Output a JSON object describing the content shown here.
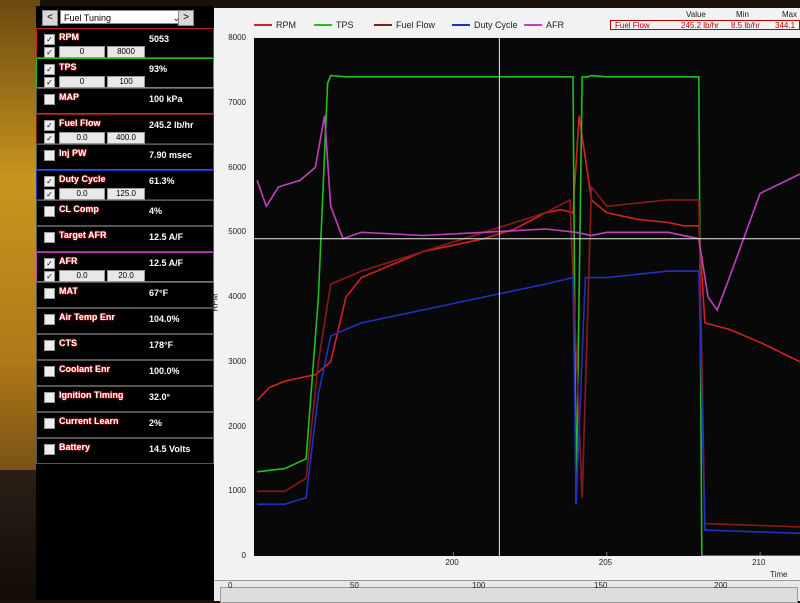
{
  "toolbar": {
    "prev_label": "<",
    "next_label": ">",
    "selector_value": "Fuel Tuning"
  },
  "sensors": [
    {
      "name": "RPM",
      "value": "5053",
      "checked": true,
      "range_min": "0",
      "range_max": "8000"
    },
    {
      "name": "TPS",
      "value": "93%",
      "checked": true,
      "range_min": "0",
      "range_max": "100"
    },
    {
      "name": "MAP",
      "value": "100 kPa",
      "checked": false
    },
    {
      "name": "Fuel Flow",
      "value": "245.2 lb/hr",
      "checked": true,
      "range_min": "0.0",
      "range_max": "400.0"
    },
    {
      "name": "Inj PW",
      "value": "7.90 msec",
      "checked": false
    },
    {
      "name": "Duty Cycle",
      "value": "61.3%",
      "checked": true,
      "range_min": "0.0",
      "range_max": "125.0"
    },
    {
      "name": "CL Comp",
      "value": "4%",
      "checked": false
    },
    {
      "name": "Target AFR",
      "value": "12.5 A/F",
      "checked": false
    },
    {
      "name": "AFR",
      "value": "12.5 A/F",
      "checked": true,
      "range_min": "0.0",
      "range_max": "20.0"
    },
    {
      "name": "MAT",
      "value": "67°F",
      "checked": false
    },
    {
      "name": "Air Temp Enr",
      "value": "104.0%",
      "checked": false
    },
    {
      "name": "CTS",
      "value": "178°F",
      "checked": false
    },
    {
      "name": "Coolant Enr",
      "value": "100.0%",
      "checked": false
    },
    {
      "name": "Ignition Timing",
      "value": "32.0°",
      "checked": false
    },
    {
      "name": "Current Learn",
      "value": "2%",
      "checked": false
    },
    {
      "name": "Battery",
      "value": "14.5 Volts",
      "checked": false
    }
  ],
  "legend": [
    {
      "name": "RPM",
      "color": "#d42020"
    },
    {
      "name": "TPS",
      "color": "#20c020"
    },
    {
      "name": "Fuel Flow",
      "color": "#8a1a1a"
    },
    {
      "name": "Duty Cycle",
      "color": "#2030c0"
    },
    {
      "name": "AFR",
      "color": "#c040c0"
    }
  ],
  "info_table": {
    "col_value": "Value",
    "col_min": "Min",
    "col_max": "Max",
    "row_name": "Fuel Flow",
    "row_value": "245.2 lb/hr",
    "row_min": "8.5 lb/hr",
    "row_max": "344.1"
  },
  "chart_data": {
    "type": "line",
    "ylabel": "RPM",
    "xlabel": "Time (sec)",
    "y_ticks": [
      "8000",
      "7000",
      "6000",
      "5000",
      "4000",
      "3000",
      "2000",
      "1000",
      "0"
    ],
    "x_ticks": [
      "200",
      "205",
      "210"
    ],
    "ylim": [
      0,
      8000
    ],
    "xlim": [
      193.5,
      211.3
    ],
    "crosshair": {
      "x": 201.5,
      "y": 4900
    },
    "series": [
      {
        "name": "RPM",
        "color": "#d42020",
        "x": [
          193.6,
          194,
          194.5,
          195,
          195.5,
          196,
          196.5,
          197,
          198,
          199,
          200,
          201,
          202,
          203,
          203.5,
          203.9,
          204.1,
          204.5,
          205,
          206,
          207,
          207.5,
          208,
          208.2,
          209,
          210,
          211.3
        ],
        "y": [
          2400,
          2600,
          2700,
          2750,
          2800,
          3000,
          4000,
          4300,
          4500,
          4700,
          4800,
          4900,
          5050,
          5300,
          5350,
          5300,
          6800,
          5500,
          5300,
          5200,
          5150,
          5100,
          5100,
          3600,
          3500,
          3300,
          3000
        ]
      },
      {
        "name": "TPS",
        "color": "#20c020",
        "x": [
          193.6,
          194.5,
          195.2,
          195.6,
          195.9,
          196.0,
          196.5,
          200,
          203,
          203.9,
          204.0,
          204.2,
          204.4,
          204.5,
          205,
          207,
          208,
          208.1,
          208.2,
          211.3
        ],
        "y": [
          1300,
          1350,
          1500,
          4000,
          7300,
          7420,
          7400,
          7400,
          7400,
          7400,
          800,
          7400,
          7400,
          7420,
          7400,
          7400,
          7400,
          0,
          0,
          0
        ]
      },
      {
        "name": "Fuel Flow",
        "color": "#8a1a1a",
        "x": [
          193.6,
          194.5,
          195.2,
          195.6,
          196,
          197,
          199,
          201,
          203,
          203.8,
          204.2,
          204.5,
          205,
          207,
          208,
          208.2,
          211.3
        ],
        "y": [
          1000,
          1000,
          1200,
          3000,
          4200,
          4400,
          4700,
          5000,
          5300,
          5500,
          900,
          5700,
          5400,
          5500,
          5500,
          500,
          450
        ]
      },
      {
        "name": "Duty Cycle",
        "color": "#2030c0",
        "x": [
          193.6,
          194.5,
          195.2,
          195.6,
          196,
          197,
          199,
          201,
          203,
          203.9,
          204.0,
          204.3,
          205,
          207,
          208,
          208.2,
          211.3
        ],
        "y": [
          800,
          800,
          900,
          2500,
          3400,
          3600,
          3800,
          4000,
          4200,
          4300,
          800,
          4300,
          4300,
          4400,
          4400,
          400,
          350
        ]
      },
      {
        "name": "AFR",
        "color": "#c040c0",
        "x": [
          193.6,
          193.9,
          194.3,
          195,
          195.5,
          195.8,
          196,
          196.4,
          197,
          199,
          201,
          203,
          204,
          204.5,
          205,
          207,
          208,
          208.3,
          208.6,
          209,
          210,
          211.3
        ],
        "y": [
          5800,
          5400,
          5700,
          5800,
          6000,
          6800,
          5400,
          4900,
          5000,
          4950,
          5000,
          5050,
          5000,
          4950,
          5000,
          5000,
          4900,
          4000,
          3800,
          4300,
          5600,
          5900
        ]
      }
    ]
  },
  "timeline": {
    "labels": [
      "0",
      "50",
      "100",
      "150",
      "200"
    ]
  }
}
